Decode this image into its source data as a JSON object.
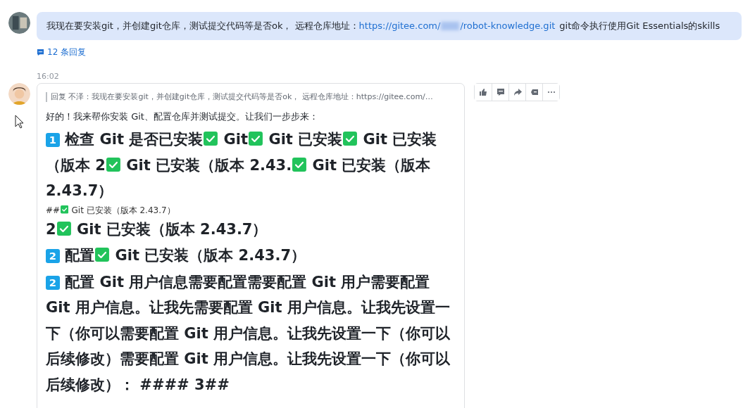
{
  "question": {
    "text_before": "我现在要安装git，并创建git仓库，测试提交代码等是否ok， 远程仓库地址：",
    "link_start": "https://gitee.com/",
    "link_end": "/robot-knowledge.git",
    "text_after": "git命令执行使用Git Essentials的skills"
  },
  "replies_link": "12 条回复",
  "time": "16:02",
  "answer": {
    "quote": "回复 不泽：我现在要安装git，并创建git仓库，测试提交代码等是否ok， 远程仓库地址：https://gitee.com/…",
    "intro": "好的！我来帮你安装 Git、配置仓库并测试提交。让我们一步步来：",
    "paragraphs": [
      {
        "kind": "heading",
        "segments": [
          {
            "kind": "key",
            "text": "1"
          },
          {
            "kind": "text",
            "text": " 检查 Git 是否已安装"
          },
          {
            "kind": "check"
          },
          {
            "kind": "text",
            "text": " Git"
          },
          {
            "kind": "check"
          },
          {
            "kind": "text",
            "text": " Git 已安装"
          },
          {
            "kind": "check"
          },
          {
            "kind": "text",
            "text": " Git 已安装（版本 2"
          },
          {
            "kind": "check"
          },
          {
            "kind": "text",
            "text": " Git 已安装（版本 2.43."
          },
          {
            "kind": "check"
          },
          {
            "kind": "text",
            "text": " Git 已安装（版本 2.43.7）"
          }
        ]
      },
      {
        "kind": "plain",
        "segments": [
          {
            "kind": "text",
            "text": "##"
          },
          {
            "kind": "check"
          },
          {
            "kind": "text",
            "text": " Git 已安装（版本 2.43.7）"
          }
        ]
      },
      {
        "kind": "heading",
        "segments": [
          {
            "kind": "text",
            "text": "2"
          },
          {
            "kind": "check"
          },
          {
            "kind": "text",
            "text": " Git 已安装（版本 2.43.7）"
          }
        ]
      },
      {
        "kind": "heading",
        "segments": [
          {
            "kind": "key",
            "text": "2"
          },
          {
            "kind": "text",
            "text": " 配置"
          },
          {
            "kind": "check"
          },
          {
            "kind": "text",
            "text": " Git 已安装（版本 2.43.7）"
          }
        ]
      },
      {
        "kind": "heading",
        "segments": [
          {
            "kind": "key",
            "text": "2"
          },
          {
            "kind": "text",
            "text": " 配置 Git 用户信息需要配置需要配置 Git 用户需要配置 Git 用户信息。让我先需要配置 Git 用户信息。让我先设置一下（你可以需要配置 Git 用户信息。让我先设置一下（你可以后续修改）需要配置 Git 用户信息。让我先设置一下（你可以后续修改）： #### 3##"
          }
        ]
      }
    ]
  }
}
